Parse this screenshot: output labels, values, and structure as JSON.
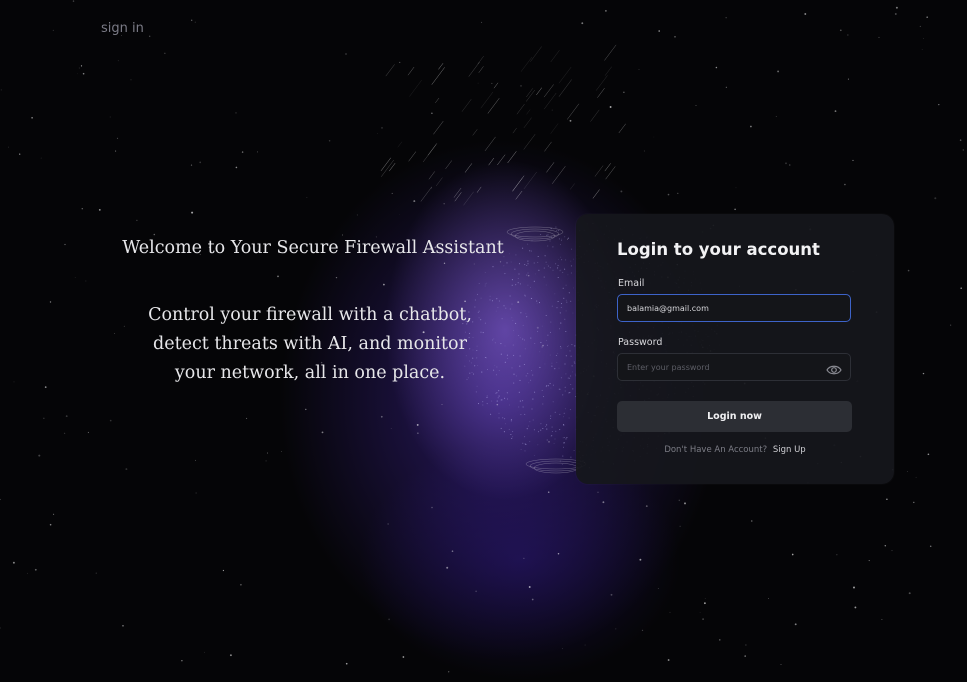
{
  "nav": {
    "sign_in": "sign in"
  },
  "hero": {
    "title": "Welcome to Your Secure Firewall Assistant",
    "subtitle_lines": [
      "Control your firewall with a chatbot,",
      "detect threats with AI, and monitor",
      "your network, all in one place."
    ]
  },
  "login_card": {
    "title": "Login to your account",
    "email": {
      "label": "Email",
      "value": "balamia@gmail.com"
    },
    "password": {
      "label": "Password",
      "placeholder": "Enter your password",
      "toggle_icon": "eye-icon"
    },
    "submit_label": "Login now",
    "signup_prompt": "Don't Have An Account?",
    "signup_link": "Sign Up"
  },
  "colors": {
    "background": "#050507",
    "card": "#16171c",
    "accent_border": "#3d63c9",
    "glow": "#7a55e6"
  }
}
